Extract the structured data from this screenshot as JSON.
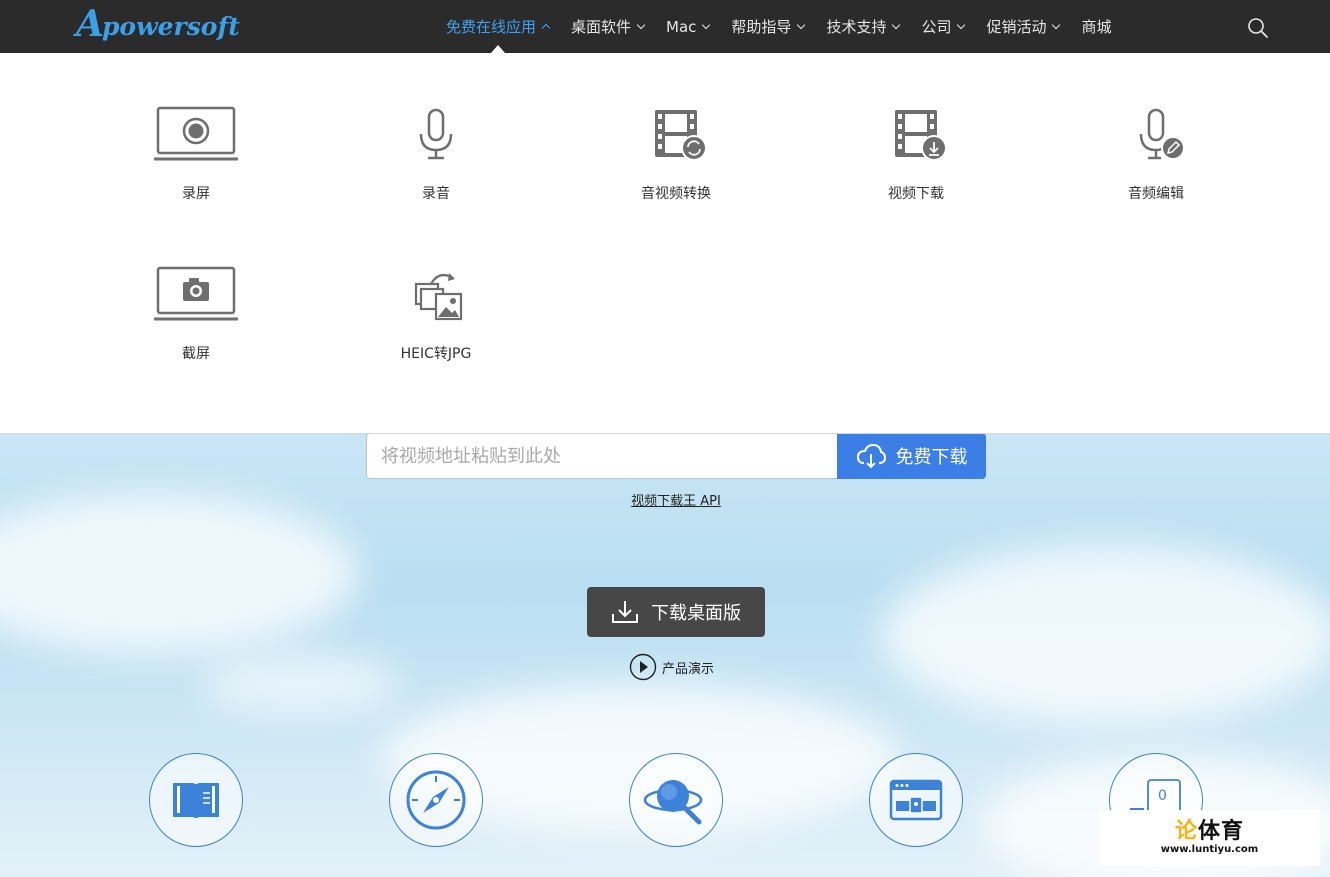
{
  "nav": {
    "logo_text": "powersoft",
    "logo_letter": "A",
    "items": [
      {
        "label": "免费在线应用",
        "active": true
      },
      {
        "label": "桌面软件"
      },
      {
        "label": "Mac"
      },
      {
        "label": "帮助指导"
      },
      {
        "label": "技术支持"
      },
      {
        "label": "公司"
      },
      {
        "label": "促销活动"
      },
      {
        "label": "商城"
      }
    ],
    "search_icon": "search-icon"
  },
  "dropdown": {
    "apps": [
      {
        "label": "录屏",
        "icon": "screen-record-icon"
      },
      {
        "label": "录音",
        "icon": "microphone-icon"
      },
      {
        "label": "音视频转换",
        "icon": "video-convert-icon"
      },
      {
        "label": "视频下载",
        "icon": "video-download-icon"
      },
      {
        "label": "音频编辑",
        "icon": "audio-edit-icon"
      },
      {
        "label": "截屏",
        "icon": "screenshot-icon"
      },
      {
        "label": "HEIC转JPG",
        "icon": "heic-to-jpg-icon"
      }
    ]
  },
  "hero": {
    "url_placeholder": "将视频地址粘贴到此处",
    "url_value": "",
    "download_label": "免费下载",
    "api_link": "视频下载王 API",
    "desktop_label": "下载桌面版",
    "demo_label": "产品演示",
    "cart_count": "0"
  },
  "watermark": {
    "name_left": "论",
    "name_right": "体育",
    "url": "www.luntiyu.com"
  },
  "colors": {
    "nav_bg": "#2b2b2b",
    "accent": "#3ea2f0",
    "button_blue": "#3a7ee6",
    "desktop_button": "#474747",
    "icon_gray": "#6e6e6e"
  }
}
